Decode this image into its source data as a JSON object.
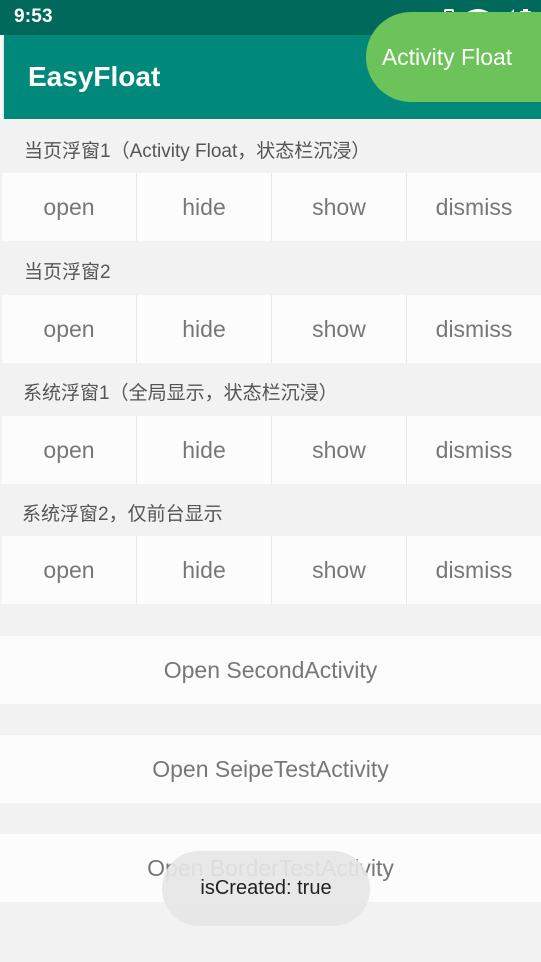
{
  "status_bar": {
    "time": "9:53",
    "icons": [
      "vibrate-icon",
      "wifi-icon",
      "signal-icon",
      "battery-icon"
    ]
  },
  "app_bar": {
    "title": "EasyFloat",
    "color": "#00897b"
  },
  "float_button": {
    "label": "Activity Float",
    "color": "#6cc35a"
  },
  "sections": [
    {
      "label": "当页浮窗1（Activity Float，状态栏沉浸）",
      "buttons": [
        "open",
        "hide",
        "show",
        "dismiss"
      ]
    },
    {
      "label": "当页浮窗2",
      "buttons": [
        "open",
        "hide",
        "show",
        "dismiss"
      ]
    },
    {
      "label": "系统浮窗1（全局显示，状态栏沉浸）",
      "buttons": [
        "open",
        "hide",
        "show",
        "dismiss"
      ]
    },
    {
      "label": "系统浮窗2，仅前台显示",
      "buttons": [
        "open",
        "hide",
        "show",
        "dismiss"
      ]
    }
  ],
  "actions": [
    {
      "label": "Open SecondActivity"
    },
    {
      "label": "Open SeipeTestActivity"
    },
    {
      "label": "Open BorderTestActivity"
    }
  ],
  "toast": {
    "text": "isCreated: true"
  }
}
